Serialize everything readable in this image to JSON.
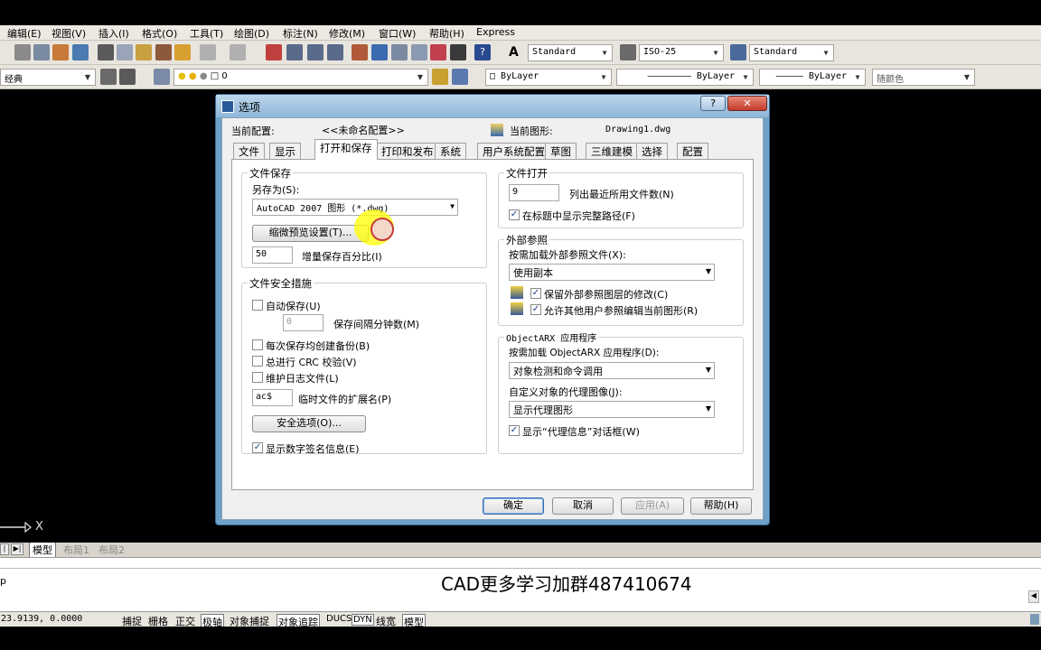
{
  "menubar": [
    "编辑(E)",
    "视图(V)",
    "插入(I)",
    "格式(O)",
    "工具(T)",
    "绘图(D)",
    "标注(N)",
    "修改(M)",
    "窗口(W)",
    "帮助(H)",
    "Express"
  ],
  "toolbar1": {
    "text_style": "Standard",
    "dim_style": "ISO-25",
    "table_style": "Standard"
  },
  "toolbar2": {
    "workspace": "经典",
    "layer": "0",
    "color": "ByLayer",
    "linetype": "ByLayer",
    "lineweight": "ByLayer",
    "plotstyle": "随颜色"
  },
  "dialog": {
    "title": "选项",
    "help_glyph": "?",
    "close_glyph": "✕",
    "current_profile_label": "当前配置:",
    "current_profile_value": "<<未命名配置>>",
    "current_drawing_label": "当前图形:",
    "current_drawing_value": "Drawing1.dwg",
    "tabs": [
      "文件",
      "显示",
      "打开和保存",
      "打印和发布",
      "系统",
      "用户系统配置",
      "草图",
      "三维建模",
      "选择",
      "配置"
    ],
    "file_save": {
      "group": "文件保存",
      "save_as_label": "另存为(S):",
      "save_as_value": "AutoCAD 2007 图形 (*.dwg)",
      "thumbnail_button": "缩微预览设置(T)...",
      "incremental_value": "50",
      "incremental_label": "增量保存百分比(I)"
    },
    "file_safety": {
      "group": "文件安全措施",
      "autosave_label": "自动保存(U)",
      "autosave_checked": false,
      "minutes_value": "0",
      "minutes_label": "保存间隔分钟数(M)",
      "backup_label": "每次保存均创建备份(B)",
      "backup_checked": false,
      "crc_label": "总进行 CRC 校验(V)",
      "crc_checked": false,
      "log_label": "维护日志文件(L)",
      "log_checked": false,
      "ext_value": "ac$",
      "ext_label": "临时文件的扩展名(P)",
      "security_button": "安全选项(O)...",
      "digsig_label": "显示数字签名信息(E)",
      "digsig_checked": true
    },
    "file_open": {
      "group": "文件打开",
      "recent_value": "9",
      "recent_label": "列出最近所用文件数(N)",
      "fullpath_label": "在标题中显示完整路径(F)",
      "fullpath_checked": true
    },
    "xref": {
      "group": "外部参照",
      "demand_label": "按需加载外部参照文件(X):",
      "demand_value": "使用副本",
      "retain_label": "保留外部参照图层的修改(C)",
      "retain_checked": true,
      "allow_label": "允许其他用户参照编辑当前图形(R)",
      "allow_checked": true
    },
    "objectarx": {
      "group": "ObjectARX 应用程序",
      "demand_label": "按需加载 ObjectARX 应用程序(D):",
      "demand_value": "对象检测和命令调用",
      "proxy_label": "自定义对象的代理图像(J):",
      "proxy_value": "显示代理图形",
      "showproxy_label": "显示“代理信息”对话框(W)",
      "showproxy_checked": true
    },
    "buttons": {
      "ok": "确定",
      "cancel": "取消",
      "apply": "应用(A)",
      "help": "帮助(H)"
    }
  },
  "layout_tabs": [
    "模型",
    "布局1",
    "布局2"
  ],
  "axis_label": "X",
  "command": {
    "prompt": "p",
    "banner": "CAD更多学习加群487410674"
  },
  "statusbar": {
    "coords": "23.9139, 0.0000",
    "items": [
      "捕捉",
      "栅格",
      "正交",
      "极轴",
      "对象捕捉",
      "对象追踪",
      "DUCS",
      "DYN",
      "线宽",
      "模型"
    ]
  },
  "colors": {
    "dialog_frame": "#6fa1c9",
    "highlight": "#ffff00"
  }
}
